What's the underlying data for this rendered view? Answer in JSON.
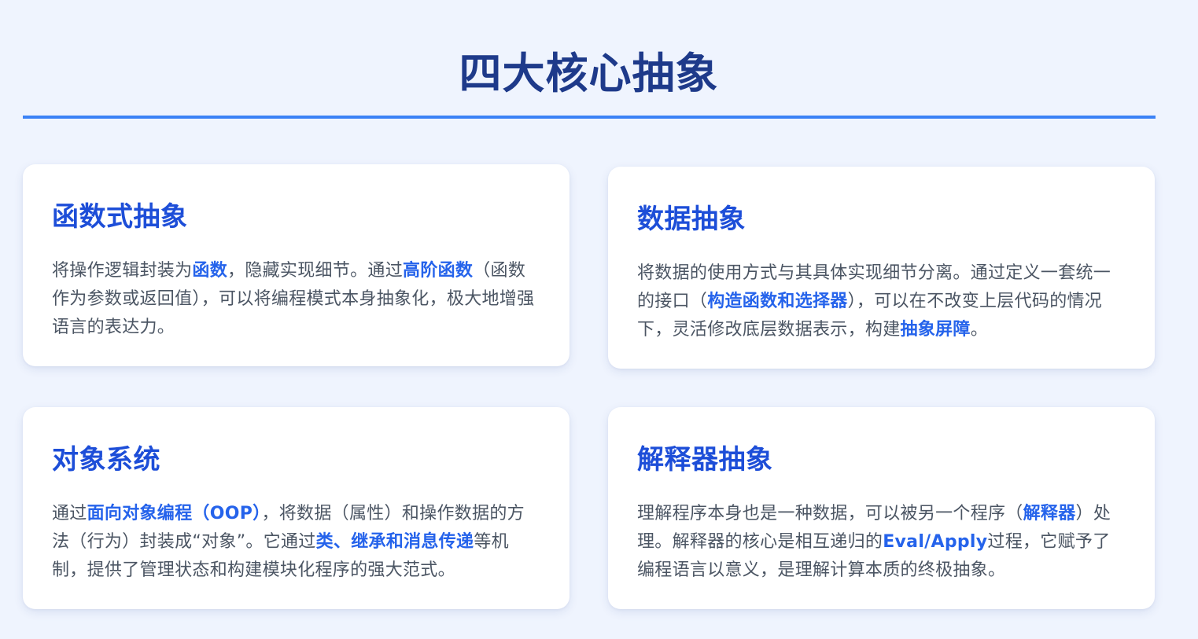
{
  "page": {
    "title": "四大核心抽象"
  },
  "cards": [
    {
      "title": "函数式抽象",
      "body": [
        {
          "text": "将操作逻辑封装为",
          "strong": false
        },
        {
          "text": "函数",
          "strong": true
        },
        {
          "text": "，隐藏实现细节。通过",
          "strong": false
        },
        {
          "text": "高阶函数",
          "strong": true
        },
        {
          "text": "（函数作为参数或返回值），可以将编程模式本身抽象化，极大地增强语言的表达力。",
          "strong": false
        }
      ]
    },
    {
      "title": "数据抽象",
      "body": [
        {
          "text": "将数据的使用方式与其具体实现细节分离。通过定义一套统一的接口（",
          "strong": false
        },
        {
          "text": "构造函数和选择器",
          "strong": true
        },
        {
          "text": "），可以在不改变上层代码的情况下，灵活修改底层数据表示，构建",
          "strong": false
        },
        {
          "text": "抽象屏障",
          "strong": true
        },
        {
          "text": "。",
          "strong": false
        }
      ]
    },
    {
      "title": "对象系统",
      "body": [
        {
          "text": "通过",
          "strong": false
        },
        {
          "text": "面向对象编程（OOP）",
          "strong": true
        },
        {
          "text": "，将数据（属性）和操作数据的方法（行为）封装成“对象”。它通过",
          "strong": false
        },
        {
          "text": "类、继承和消息传递",
          "strong": true
        },
        {
          "text": "等机制，提供了管理状态和构建模块化程序的强大范式。",
          "strong": false
        }
      ]
    },
    {
      "title": "解释器抽象",
      "body": [
        {
          "text": "理解程序本身也是一种数据，可以被另一个程序（",
          "strong": false
        },
        {
          "text": "解释器",
          "strong": true
        },
        {
          "text": "）处理。解释器的核心是相互递归的",
          "strong": false
        },
        {
          "text": "Eval/Apply",
          "strong": true
        },
        {
          "text": "过程，它赋予了编程语言以意义，是理解计算本质的终极抽象。",
          "strong": false
        }
      ]
    }
  ],
  "colors": {
    "background": "#eff4fe",
    "title": "#1e3a8a",
    "rule": "#3b82f6",
    "card_title": "#1d4ed8",
    "highlight": "#2563eb",
    "body_text": "#4b5563"
  }
}
